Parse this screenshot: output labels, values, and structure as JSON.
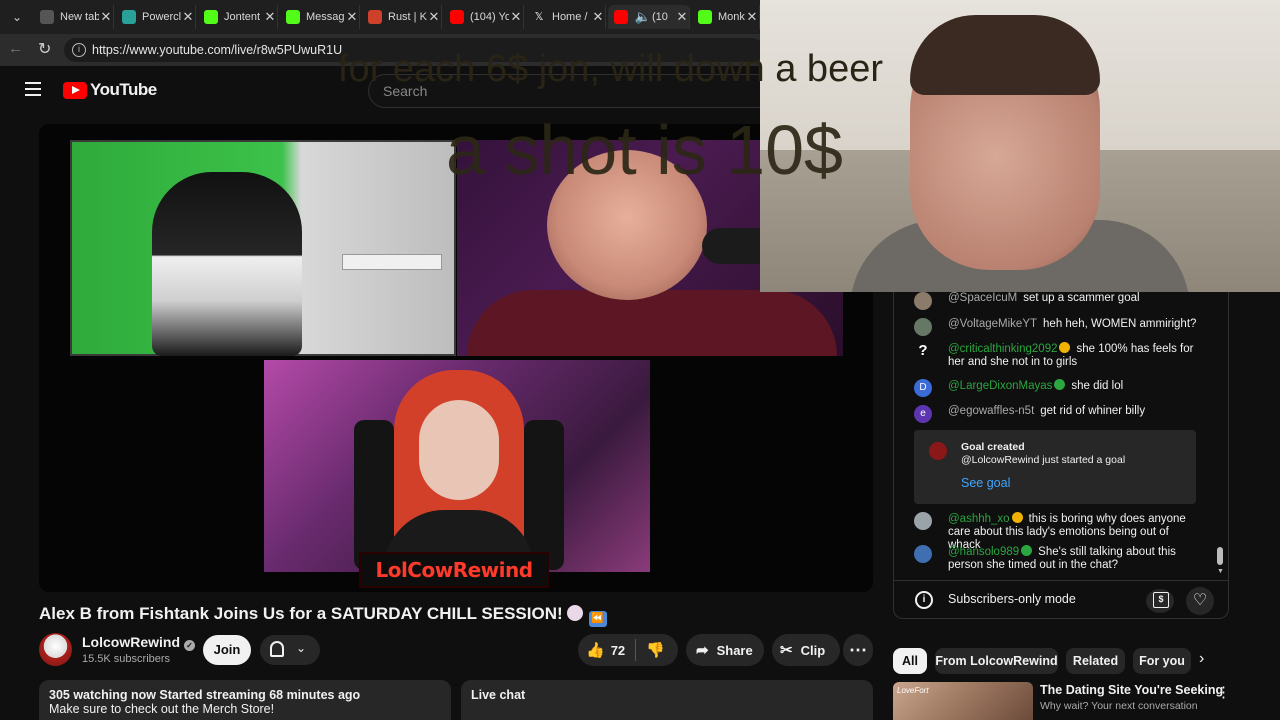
{
  "browser": {
    "tabs": [
      {
        "label": "New tab",
        "color": "#555555"
      },
      {
        "label": "Powercl",
        "color": "#2aa198"
      },
      {
        "label": "Jontent",
        "color": "#53fc18"
      },
      {
        "label": "Messag",
        "color": "#53fc18"
      },
      {
        "label": "Rust | K",
        "color": "#cd412b"
      },
      {
        "label": "(104) Yo",
        "color": "#ff0000"
      },
      {
        "label": "Home /",
        "color": "#1f1f1f"
      },
      {
        "label": "(10",
        "color": "#ff0000"
      },
      {
        "label": "Monkey",
        "color": "#53fc18"
      }
    ],
    "close_glyph": "✕",
    "url": "https://www.youtube.com/live/r8w5PUwuR1U"
  },
  "youtube": {
    "logo_text": "YouTube",
    "search_placeholder": "Search"
  },
  "video": {
    "overlay_line1": "for each 6$ jon, will down a beer",
    "overlay_line2": "a shot is 10$",
    "brand_tag": "LolCowRewind",
    "title": "Alex B from Fishtank Joins Us for a SATURDAY CHILL SESSION!"
  },
  "channel": {
    "name": "LolcowRewind",
    "subscribers": "15.5K subscribers",
    "join_label": "Join"
  },
  "actions": {
    "like_count": "72",
    "share_label": "Share",
    "clip_label": "Clip",
    "more_glyph": "⋯"
  },
  "description": {
    "line1": "305 watching now  Started streaming 68 minutes ago",
    "line2": "Make sure to check out the Merch Store!"
  },
  "live_chat_label": "Live chat",
  "chat": {
    "messages": [
      {
        "author": "@SpaceIcuM",
        "text": "set up a scammer goal",
        "avatar_color": "#8b7b6a"
      },
      {
        "author": "@VoltageMikeYT",
        "text": "heh heh, WOMEN ammiright?",
        "avatar_color": "#667766"
      },
      {
        "author": "@criticalthinking2092",
        "text": "she 100% has feels for her and she not in to girls",
        "avatar_color": "#0f0f0f",
        "avatar_glyph": "?",
        "badge_color": "#f2b200"
      },
      {
        "author": "@LargeDixonMayas",
        "text": "she did lol",
        "avatar_color": "#3a6bd6",
        "avatar_glyph": "D",
        "badge_color": "#2ba640"
      },
      {
        "author": "@egowaffles-n5t",
        "text": "get rid of whiner billy",
        "avatar_color": "#5e35b1",
        "avatar_glyph": "e"
      },
      {
        "author": "@ashhh_xo",
        "text": "this is boring why does anyone care about this lady's emotions being out of whack",
        "avatar_color": "#9aa3a8",
        "badge_color": "#f2b200"
      },
      {
        "author": "@hansolo989",
        "text": "She's still talking about this person she timed out in the chat?",
        "avatar_color": "#3f6fb0",
        "badge_color": "#2ba640"
      }
    ],
    "goal": {
      "title": "Goal created",
      "subtitle": "@LolcowRewind just started a goal",
      "link": "See goal"
    },
    "mode_text": "Subscribers-only mode"
  },
  "chips": [
    "All",
    "From LolcowRewind",
    "Related",
    "For you"
  ],
  "recommendation": {
    "thumb_brand": "LoveFort",
    "title": "The Dating Site You're Seeking",
    "subtitle": "Why wait? Your next conversation"
  }
}
